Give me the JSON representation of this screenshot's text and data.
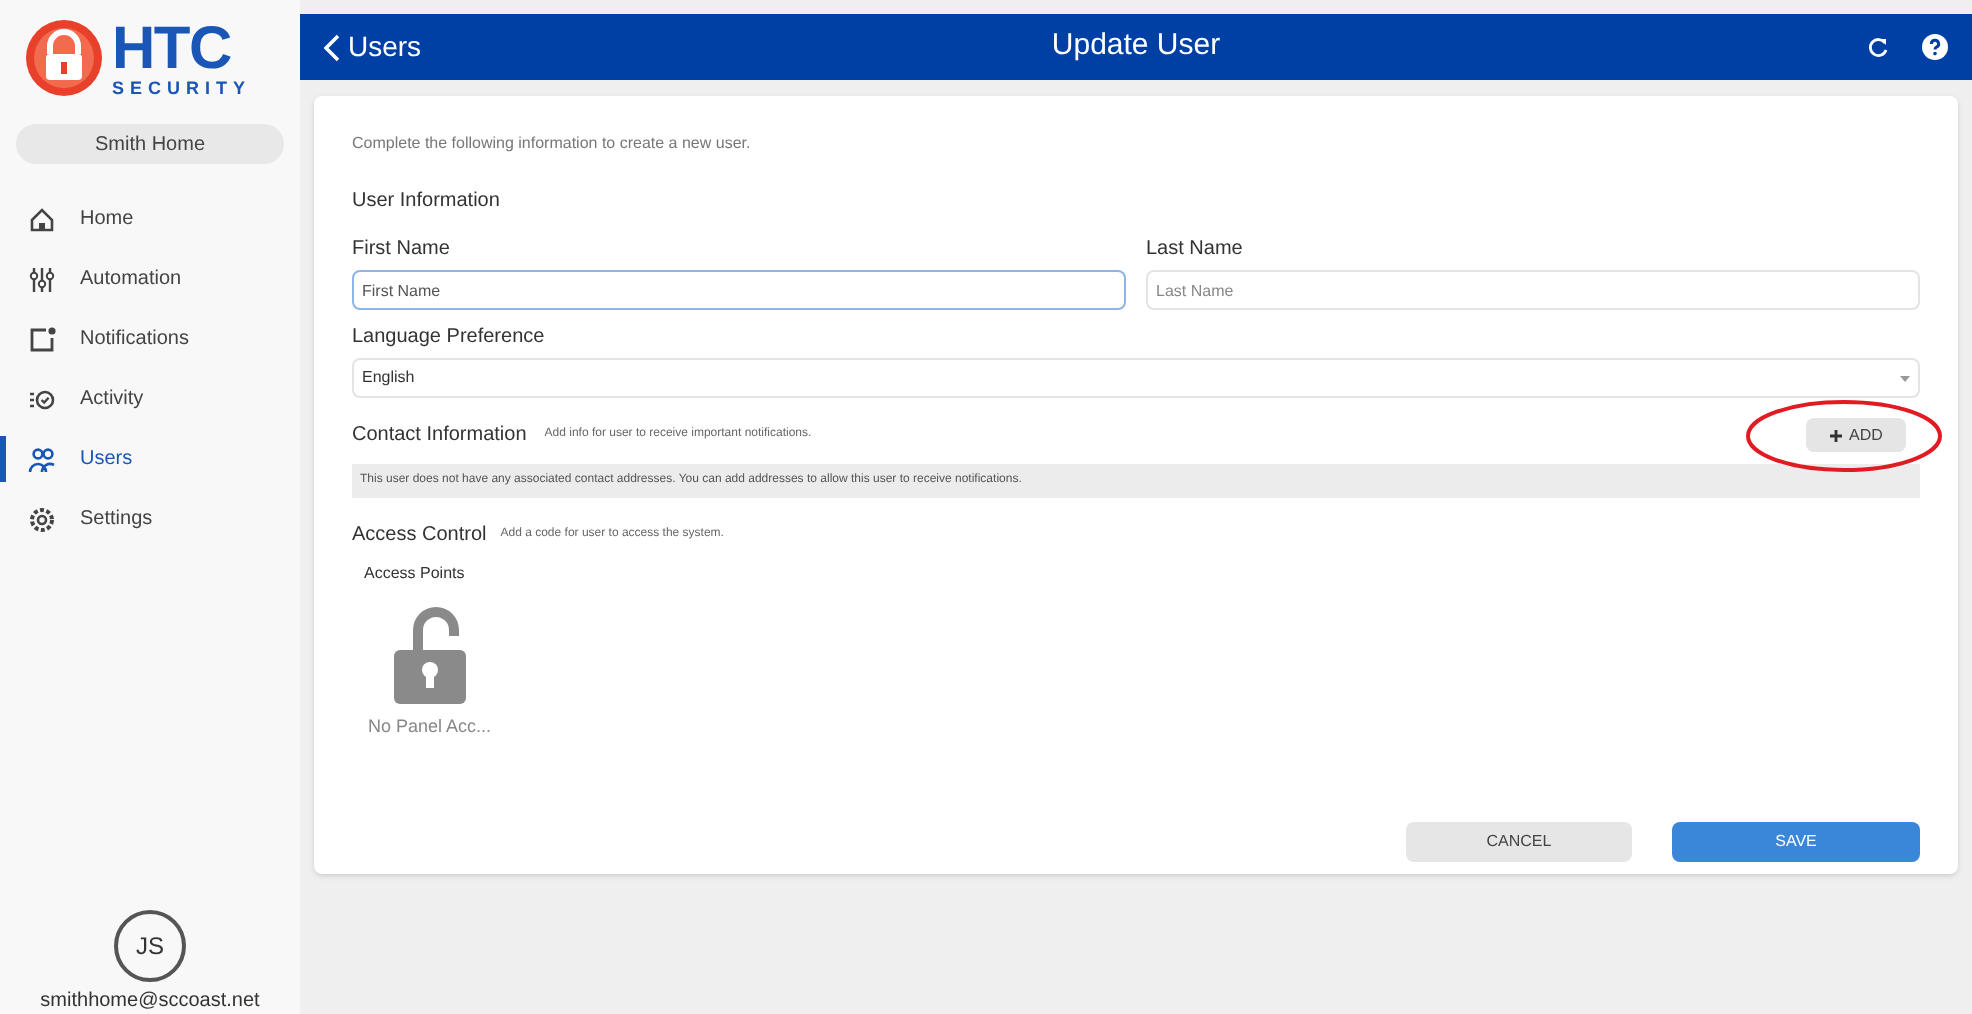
{
  "logo": {
    "name": "HTC",
    "tagline": "SECURITY"
  },
  "location_button": "Smith Home",
  "sidebar": {
    "items": [
      {
        "kind": "home",
        "label": "Home",
        "selected": false
      },
      {
        "kind": "automation",
        "label": "Automation",
        "selected": false
      },
      {
        "kind": "notifications",
        "label": "Notifications",
        "selected": false
      },
      {
        "kind": "activity",
        "label": "Activity",
        "selected": false
      },
      {
        "kind": "users",
        "label": "Users",
        "selected": true
      },
      {
        "kind": "settings",
        "label": "Settings",
        "selected": false
      }
    ]
  },
  "account": {
    "initials": "JS",
    "email": "smithhome@sccoast.net"
  },
  "header": {
    "back": "Users",
    "title": "Update User"
  },
  "form": {
    "intro": "Complete the following information to create a new user.",
    "user_section": "User Information",
    "first_name": {
      "label": "First Name",
      "placeholder": "First Name",
      "focused": true
    },
    "last_name": {
      "label": "Last Name",
      "placeholder": "Last Name",
      "focused": false
    },
    "language": {
      "label": "Language Preference",
      "value": "English"
    },
    "contact": {
      "title": "Contact Information",
      "hint": "Add info for user to receive important notifications.",
      "add_button": "ADD",
      "empty_note": "This user does not have any associated contact addresses. You can add addresses to allow this user to receive notifications."
    },
    "access": {
      "title": "Access Control",
      "hint": "Add a code for user to access the system.",
      "points_label": "Access Points",
      "points": [
        {
          "label": "No Panel Acc..."
        }
      ]
    },
    "buttons": {
      "cancel": "CANCEL",
      "save": "SAVE"
    }
  }
}
